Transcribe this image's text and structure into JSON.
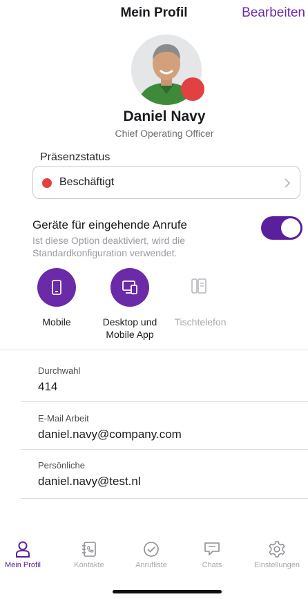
{
  "header": {
    "title": "Mein Profil",
    "edit_label": "Bearbeiten"
  },
  "profile": {
    "name": "Daniel Navy",
    "role": "Chief Operating Officer",
    "status_color": "#e24142"
  },
  "presence": {
    "section_label": "Präsenzstatus",
    "status_label": "Beschäftigt",
    "status_color": "#e24142"
  },
  "devices": {
    "title": "Geräte für eingehende Anrufe",
    "subtitle": "Ist diese Option deaktiviert, wird die Standardkonfiguration verwendet.",
    "toggle_on": true,
    "items": [
      {
        "label": "Mobile",
        "icon": "mobile-phone-icon",
        "active": true
      },
      {
        "label": "Desktop und Mobile App",
        "icon": "desktop-and-mobile-icon",
        "active": true
      },
      {
        "label": "Tischtelefon",
        "icon": "desk-phone-icon",
        "active": false
      }
    ]
  },
  "fields": [
    {
      "label": "Durchwahl",
      "value": "414"
    },
    {
      "label": "E-Mail Arbeit",
      "value": "daniel.navy@company.com"
    },
    {
      "label": "Persönliche",
      "value": "daniel.navy@test.nl"
    }
  ],
  "tabs": [
    {
      "label": "Mein Profil",
      "icon": "person-icon",
      "active": true
    },
    {
      "label": "Kontakte",
      "icon": "address-book-icon",
      "active": false
    },
    {
      "label": "Anrufliste",
      "icon": "call-history-icon",
      "active": false
    },
    {
      "label": "Chats",
      "icon": "chat-icon",
      "active": false
    },
    {
      "label": "Einstellungen",
      "icon": "gear-icon",
      "active": false
    }
  ],
  "colors": {
    "accent": "#6b2aa8",
    "accent_dark": "#5a1f9d",
    "busy": "#e24142"
  }
}
